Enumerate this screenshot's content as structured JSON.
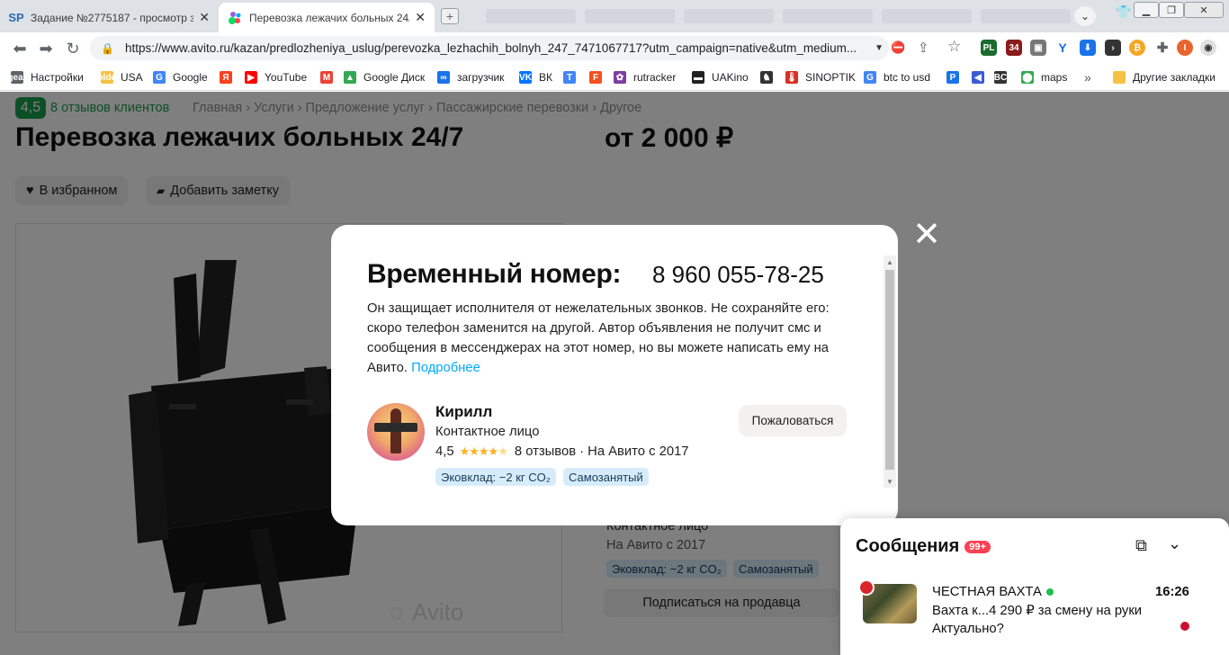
{
  "browser": {
    "tabs": [
      {
        "favicon": "SP",
        "title": "Задание №2775187 - просмотр з",
        "active": false
      },
      {
        "favicon": "avito",
        "title": "Перевозка лежачих больных 24/",
        "active": true
      }
    ],
    "new_tab_icon": "plus-icon",
    "url": "https://www.avito.ru/kazan/predlozheniya_uslug/perevozka_lezhachih_bolnyh_247_7471067717?utm_campaign=native&utm_medium...",
    "bookmarks": [
      {
        "icon": "gear",
        "label": "Настройки",
        "color": "#5f6368"
      },
      {
        "icon": "folder",
        "label": "USA",
        "color": "#f6c244"
      },
      {
        "icon": "G",
        "label": "Google",
        "color": "#4285f4"
      },
      {
        "icon": "Я",
        "label": "",
        "color": "#fc3f1d"
      },
      {
        "icon": "▶",
        "label": "YouTube",
        "color": "#ff0000"
      },
      {
        "icon": "M",
        "label": "",
        "color": "#ea4335"
      },
      {
        "icon": "▲",
        "label": "Google Диск",
        "color": "#34a853"
      },
      {
        "icon": "∞",
        "label": "загрузчик",
        "color": "#1a73e8"
      },
      {
        "icon": "VK",
        "label": "ВК",
        "color": "#0077ff"
      },
      {
        "icon": "T",
        "label": "",
        "color": "#4285f4"
      },
      {
        "icon": "F",
        "label": "",
        "color": "#f4511e"
      },
      {
        "icon": "✿",
        "label": "rutracker",
        "color": "#7b3fa0"
      },
      {
        "icon": "▬",
        "label": "UAKino",
        "color": "#222222"
      },
      {
        "icon": "♞",
        "label": "",
        "color": "#333333"
      },
      {
        "icon": "🌡",
        "label": "SINOPTIK",
        "color": "#d93025"
      },
      {
        "icon": "G",
        "label": "btc to usd",
        "color": "#4285f4"
      },
      {
        "icon": "P",
        "label": "",
        "color": "#1a73e8"
      },
      {
        "icon": "◀",
        "label": "",
        "color": "#3c5bd6"
      },
      {
        "icon": "BC",
        "label": "",
        "color": "#333333"
      },
      {
        "icon": "⬤",
        "label": "maps",
        "color": "#34a853"
      }
    ],
    "more_bookmarks": "»",
    "other_bookmarks": "Другие закладки"
  },
  "page": {
    "rating_value": "4,5",
    "reviews_link": "8 отзывов клиентов",
    "breadcrumbs": "Главная › Услуги › Предложение услуг › Пассажирские перевозки › Другое",
    "title": "Перевозка лежачих больных 24/7",
    "price": "от 2 000 ₽",
    "favorite_button": "В избранном",
    "note_button": "Добавить заметку",
    "photo_watermark": "Avito",
    "seller_role": "Контактное лицо",
    "seller_since": "На Авито с 2017",
    "eco_chip": "Эковклад: −2 кг CO₂",
    "selfemployed_chip": "Самозанятый",
    "subscribe_button": "Подписаться на продавца"
  },
  "modal": {
    "title": "Временный номер:",
    "phone": "8 960 055-78-25",
    "description": "Он защищает исполнителя от нежелательных звонков. Не сохраняйте его: скоро телефон заменится на другой. Автор объявления не получит смс и сообщения в мессенджерах на этот номер, но вы можете написать ему на Авито.",
    "more_link": "Подробнее",
    "seller": {
      "name": "Кирилл",
      "role": "Контактное лицо",
      "rating": "4,5",
      "stars": 4.5,
      "reviews": "8 отзывов",
      "since": "· На Авито с 2017",
      "chips": [
        "Эковклад: −2 кг CO₂",
        "Самозанятый"
      ]
    },
    "complain_button": "Пожаловаться",
    "close_icon": "close-icon"
  },
  "messenger": {
    "title": "Сообщения",
    "badge": "99+",
    "chat": {
      "name": "ЧЕСТНАЯ ВАХТА",
      "time": "16:26",
      "text": "Вахта к...4 290 ₽ за смену на руки Актуально?",
      "online": true,
      "unread": true
    }
  },
  "colors": {
    "avito_green": "#1a9e4a",
    "link_blue": "#00aaff",
    "chip_bg": "#d6ecfb",
    "badge_red": "#ff4053"
  }
}
